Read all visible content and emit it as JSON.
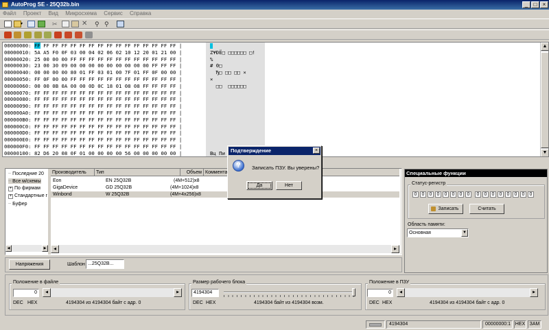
{
  "window": {
    "title": "AutoProg SE - 25Q32b.bin",
    "controls": {
      "minimize": "_",
      "maximize": "□",
      "close": "×"
    }
  },
  "menu": [
    "Файл",
    "Проект",
    "Вид",
    "Микросхема",
    "Сервис",
    "Справка"
  ],
  "toolbar1_icons": [
    "new-icon",
    "open-icon",
    "save-icon",
    "export-icon",
    "cut-icon",
    "copy-icon",
    "paste-icon",
    "delete-icon",
    "find-icon",
    "find-next-icon",
    "goto-icon"
  ],
  "toolbar2_icons": [
    "read-icon",
    "write-icon",
    "verify-icon",
    "erase-icon",
    "blank-check-icon",
    "auto-icon",
    "protect-icon",
    "unprotect-icon",
    "settings-icon"
  ],
  "hex": {
    "lines": [
      {
        "addr": "00000000:",
        "bytes": "FF FF FF FF FF FF FF FF FF FF FF FF FF FF FF FF |",
        "ascii": ""
      },
      {
        "addr": "00000010:",
        "bytes": "5A A5 F0 0F 03 00 04 02 06 02 10 12 20 01 21 00 |",
        "ascii": "Z¥ÐЁ□ □□□□□□ □!"
      },
      {
        "addr": "00000020:",
        "bytes": "25 00 00 00 FF FF FF FF FF FF FF FF FF FF FF FF |",
        "ascii": "%"
      },
      {
        "addr": "00000030:",
        "bytes": "23 00 30 09 00 00 00 00 00 00 00 00 00 FF FF FF |",
        "ascii": "# 0□"
      },
      {
        "addr": "00000040:",
        "bytes": "00 00 00 00 80 01 FF 03 01 00 7F 01 FF 0F 00 00 |",
        "ascii": "  Ђ□ □□ □□ ×"
      },
      {
        "addr": "00000050:",
        "bytes": "FF 0F 00 00 FF FF FF FF FF FF FF FF FF FF FF FF |",
        "ascii": "×"
      },
      {
        "addr": "00000060:",
        "bytes": "00 00 0B 0A 00 00 0D 0C 18 01 08 08 FF FF FF FF |",
        "ascii": "  □□  □□□□□□"
      },
      {
        "addr": "00000070:",
        "bytes": "FF FF FF FF FF FF FF FF FF FF FF FF FF FF FF FF |",
        "ascii": ""
      },
      {
        "addr": "00000080:",
        "bytes": "FF FF FF FF FF FF FF FF FF FF FF FF FF FF FF FF |",
        "ascii": ""
      },
      {
        "addr": "00000090:",
        "bytes": "FF FF FF FF FF FF FF FF FF FF FF FF FF FF FF FF |",
        "ascii": ""
      },
      {
        "addr": "000000A0:",
        "bytes": "FF FF FF FF FF FF FF FF FF FF FF FF FF FF FF FF |",
        "ascii": ""
      },
      {
        "addr": "000000B0:",
        "bytes": "FF FF FF FF FF FF FF FF FF FF FF FF FF FF FF FF |",
        "ascii": ""
      },
      {
        "addr": "000000C0:",
        "bytes": "FF FF FF FF FF FF FF FF FF FF FF FF FF FF FF FF |",
        "ascii": ""
      },
      {
        "addr": "000000D0:",
        "bytes": "FF FF FF FF FF FF FF FF FF FF FF FF FF FF FF FF |",
        "ascii": ""
      },
      {
        "addr": "000000E0:",
        "bytes": "FF FF FF FF FF FF FF FF FF FF FF FF FF FF FF FF |",
        "ascii": ""
      },
      {
        "addr": "000000F0:",
        "bytes": "FF FF FF FF FF FF FF FF FF FF FF FF FF FF FF FF |",
        "ascii": ""
      },
      {
        "addr": "00000100:",
        "bytes": "82 D6 20 08 0F 01 00 00 00 00 56 00 00 00 00 00 |",
        "ascii": "Вц Пи"
      }
    ],
    "first_byte": "FF",
    "first_byte_rest": " FF FF FF FF FF FF FF FF FF FF FF FF FF FF FF |",
    "highlight_color": "#00c0e0"
  },
  "tree": {
    "items": [
      "Последние 20",
      "Все м/схемы",
      "По фирмам",
      "Стандартные г",
      "Буфер"
    ]
  },
  "chip_table": {
    "headers": [
      "Производитель",
      "Тип",
      "Объем",
      "Коммента"
    ],
    "rows": [
      {
        "maker": "Eon",
        "type": "EN 25Q32B",
        "size": "(4M+512)x8"
      },
      {
        "maker": "GigaDevice",
        "type": "GD 25Q32B",
        "size": "(4M+1024)x8"
      },
      {
        "maker": "Winbond",
        "type": "W 25Q32B",
        "size": "(4M+4x256)x8"
      }
    ]
  },
  "voltage_button": "Напряжения",
  "template": {
    "label": "Шаблон",
    "value": "...25Q32B..."
  },
  "special": {
    "header": "Специальные функции",
    "status_label": "Статус-регистр",
    "bits": [
      "0",
      "0",
      "0",
      "0",
      "0",
      "0",
      "0",
      "0",
      "0",
      "0",
      "0",
      "0",
      "0",
      "0",
      "0",
      "0"
    ],
    "write_button": "Записать",
    "read_button": "Считать",
    "memory_area_label": "Область памяти:",
    "memory_area_value": "Основная"
  },
  "file_position": {
    "label": "Положение в файле",
    "value": "0",
    "dec": "DEC",
    "hex": "HEX",
    "info": "4194304 из 4194304 байт с адр. 0"
  },
  "block_size": {
    "label": "Размер рабочего блока",
    "value": "4194304",
    "dec": "DEC",
    "hex": "HEX",
    "info": "4194304 байт из 4194304 возм."
  },
  "rom_position": {
    "label": "Положение в ПЗУ",
    "value": "0",
    "dec": "DEC",
    "hex": "HEX",
    "info": "4194304 из 4194304 байт с адр. 0"
  },
  "dialog": {
    "title": "Подтверждение",
    "message": "Записать ПЗУ. Вы уверены?",
    "yes": "Да",
    "no": "Нет",
    "close": "×"
  },
  "status": {
    "size": "4194304",
    "checksum": "00000000:1",
    "mode": "HEX",
    "insert": "ЗАМ"
  }
}
